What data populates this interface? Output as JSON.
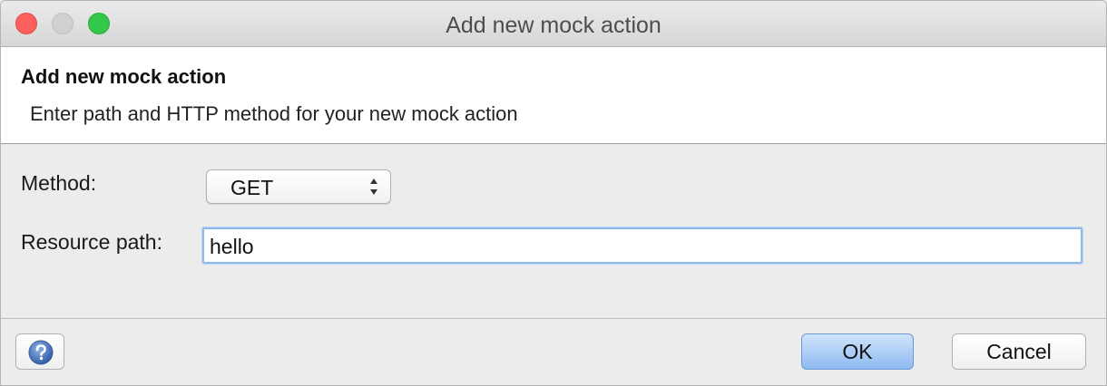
{
  "window": {
    "title": "Add new mock action",
    "traffic_lights": [
      "close-button",
      "minimize-button",
      "zoom-button"
    ]
  },
  "header": {
    "title": "Add new mock action",
    "description": "Enter path and HTTP method for your new mock action"
  },
  "form": {
    "method_label": "Method:",
    "method_value": "GET",
    "path_label": "Resource path:",
    "path_value": "hello"
  },
  "footer": {
    "help_icon": "help-question-icon",
    "ok_label": "OK",
    "cancel_label": "Cancel"
  },
  "colors": {
    "accent": "#8ebaf2",
    "focus_ring": "#8fb9e8",
    "close": "#fc605c",
    "zoom": "#34c84a"
  }
}
